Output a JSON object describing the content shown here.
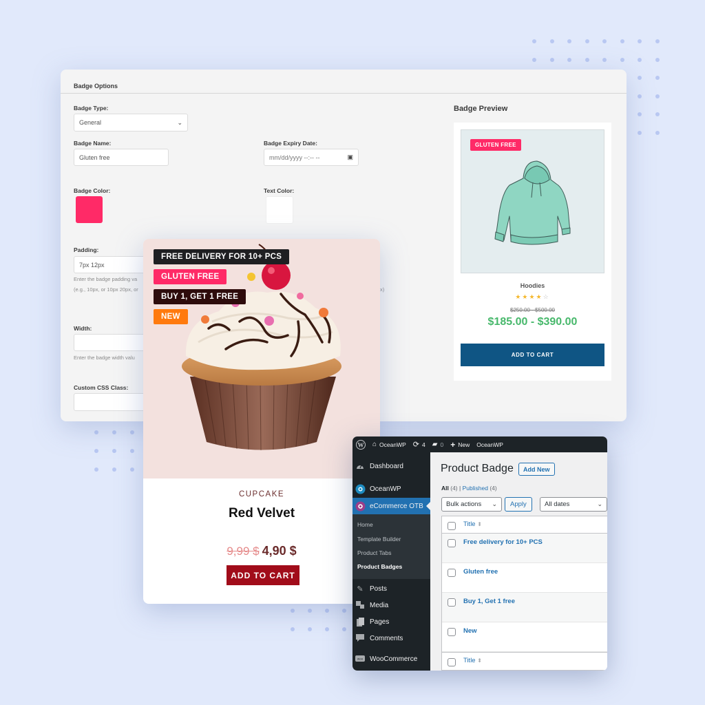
{
  "badge_options": {
    "header": "Badge Options",
    "badge_type": {
      "label": "Badge Type:",
      "value": "General"
    },
    "badge_name": {
      "label": "Badge Name:",
      "value": "Gluten free"
    },
    "badge_expiry": {
      "label": "Badge Expiry Date:",
      "placeholder": "mm/dd/yyyy --:-- --"
    },
    "badge_color": {
      "label": "Badge Color:",
      "value": "#ff2a67"
    },
    "text_color": {
      "label": "Text Color:",
      "value": "#ffffff"
    },
    "padding": {
      "label": "Padding:",
      "value": "7px 12px",
      "help_line1": "Enter the badge padding va",
      "help_line2": "(e.g., 10px, or 10px 20px, or",
      "help_tail": "x)"
    },
    "width": {
      "label": "Width:",
      "value": "",
      "help": "Enter the badge width valu"
    },
    "custom_css": {
      "label": "Custom CSS Class:",
      "value": ""
    }
  },
  "badge_preview": {
    "title": "Badge Preview",
    "badge_label": "GLUTEN FREE",
    "product_name": "Hoodies",
    "rating": {
      "value": 4,
      "max": 5,
      "filled": "★★★★",
      "empty": "☆"
    },
    "old_price": "$250.00 - $500.00",
    "price": "$185.00 - $390.00",
    "add_to_cart": "ADD TO CART"
  },
  "cupcake_card": {
    "badges": [
      {
        "label": "FREE DELIVERY FOR 10+ PCS",
        "color": "#1f1f22"
      },
      {
        "label": "GLUTEN FREE",
        "color": "#ff2a67"
      },
      {
        "label": "BUY 1, GET 1 FREE",
        "color": "#2e0c0c"
      },
      {
        "label": "NEW",
        "color": "#ff7a0e"
      }
    ],
    "category": "CUPCAKE",
    "name": "Red Velvet",
    "old_price": "9,99 $",
    "price": "4,90 $",
    "add_to_cart": "ADD TO CART"
  },
  "wp_admin": {
    "admin_bar": {
      "site": "OceanWP",
      "updates": "4",
      "comments": "0",
      "new": "New",
      "theme": "OceanWP"
    },
    "sidebar": {
      "items": [
        {
          "label": "Dashboard",
          "icon": "dashboard-icon"
        },
        {
          "label": "OceanWP",
          "icon": "oceanwp-icon"
        },
        {
          "label": "eCommerce OTB",
          "icon": "ecommerce-otb-icon",
          "active": true
        },
        {
          "label": "Posts",
          "icon": "pin-icon"
        },
        {
          "label": "Media",
          "icon": "media-icon"
        },
        {
          "label": "Pages",
          "icon": "pages-icon"
        },
        {
          "label": "Comments",
          "icon": "comment-icon"
        },
        {
          "label": "WooCommerce",
          "icon": "woocommerce-icon"
        }
      ],
      "submenu": [
        {
          "label": "Home"
        },
        {
          "label": "Template Builder"
        },
        {
          "label": "Product Tabs"
        },
        {
          "label": "Product Badges",
          "current": true
        }
      ]
    },
    "page_title": "Product Badge",
    "add_new": "Add New",
    "views": {
      "all": "All",
      "all_count": "(4)",
      "separator": "|",
      "published": "Published",
      "published_count": "(4)"
    },
    "bulk_actions": "Bulk actions",
    "apply": "Apply",
    "date_filter": "All dates",
    "column_title": "Title",
    "rows": [
      "Free delivery for 10+ PCS",
      "Gluten free",
      "Buy 1, Get 1 free",
      "New"
    ]
  }
}
